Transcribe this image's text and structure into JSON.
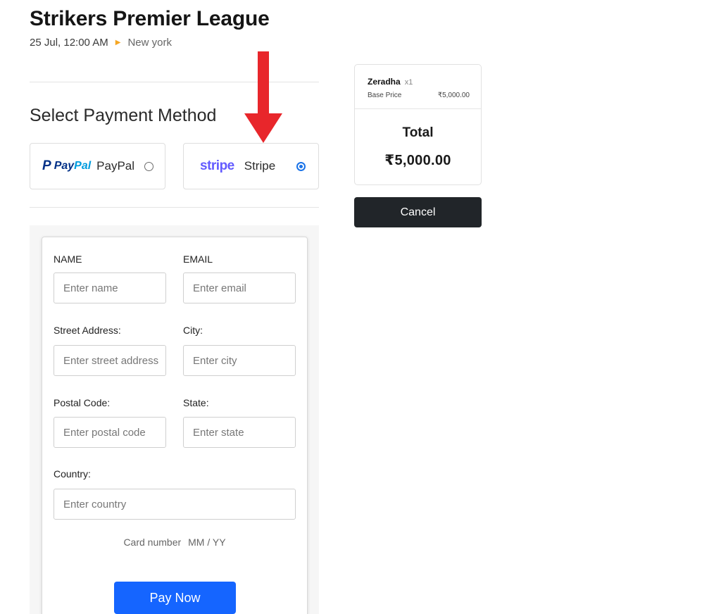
{
  "event": {
    "title": "Strikers Premier League",
    "datetime": "25 Jul, 12:00 AM",
    "location": "New york"
  },
  "payment": {
    "section_title": "Select Payment Method",
    "methods": [
      {
        "id": "paypal",
        "logo_text_a": "Pay",
        "logo_text_b": "Pal",
        "label": "PayPal",
        "selected": false
      },
      {
        "id": "stripe",
        "logo_text": "stripe",
        "label": "Stripe",
        "selected": true
      }
    ]
  },
  "form": {
    "name_label": "NAME",
    "name_placeholder": "Enter name",
    "email_label": "EMAIL",
    "email_placeholder": "Enter email",
    "street_label": "Street Address:",
    "street_placeholder": "Enter street address",
    "city_label": "City:",
    "city_placeholder": "Enter city",
    "postal_label": "Postal Code:",
    "postal_placeholder": "Enter postal code",
    "state_label": "State:",
    "state_placeholder": "Enter state",
    "country_label": "Country:",
    "country_placeholder": "Enter country",
    "card_number_placeholder": "Card number",
    "card_expiry_placeholder": "MM / YY",
    "pay_label": "Pay Now"
  },
  "summary": {
    "item_name": "Zeradha",
    "item_qty": "x1",
    "base_price_label": "Base Price",
    "base_price": "₹5,000.00",
    "total_label": "Total",
    "total_value": "₹5,000.00",
    "cancel_label": "Cancel"
  },
  "colors": {
    "accent_blue": "#1565ff",
    "stripe_purple": "#635bff",
    "paypal_navy": "#003087",
    "paypal_light": "#009cde",
    "annotation_red": "#e8262b",
    "cancel_dark": "#212529"
  }
}
